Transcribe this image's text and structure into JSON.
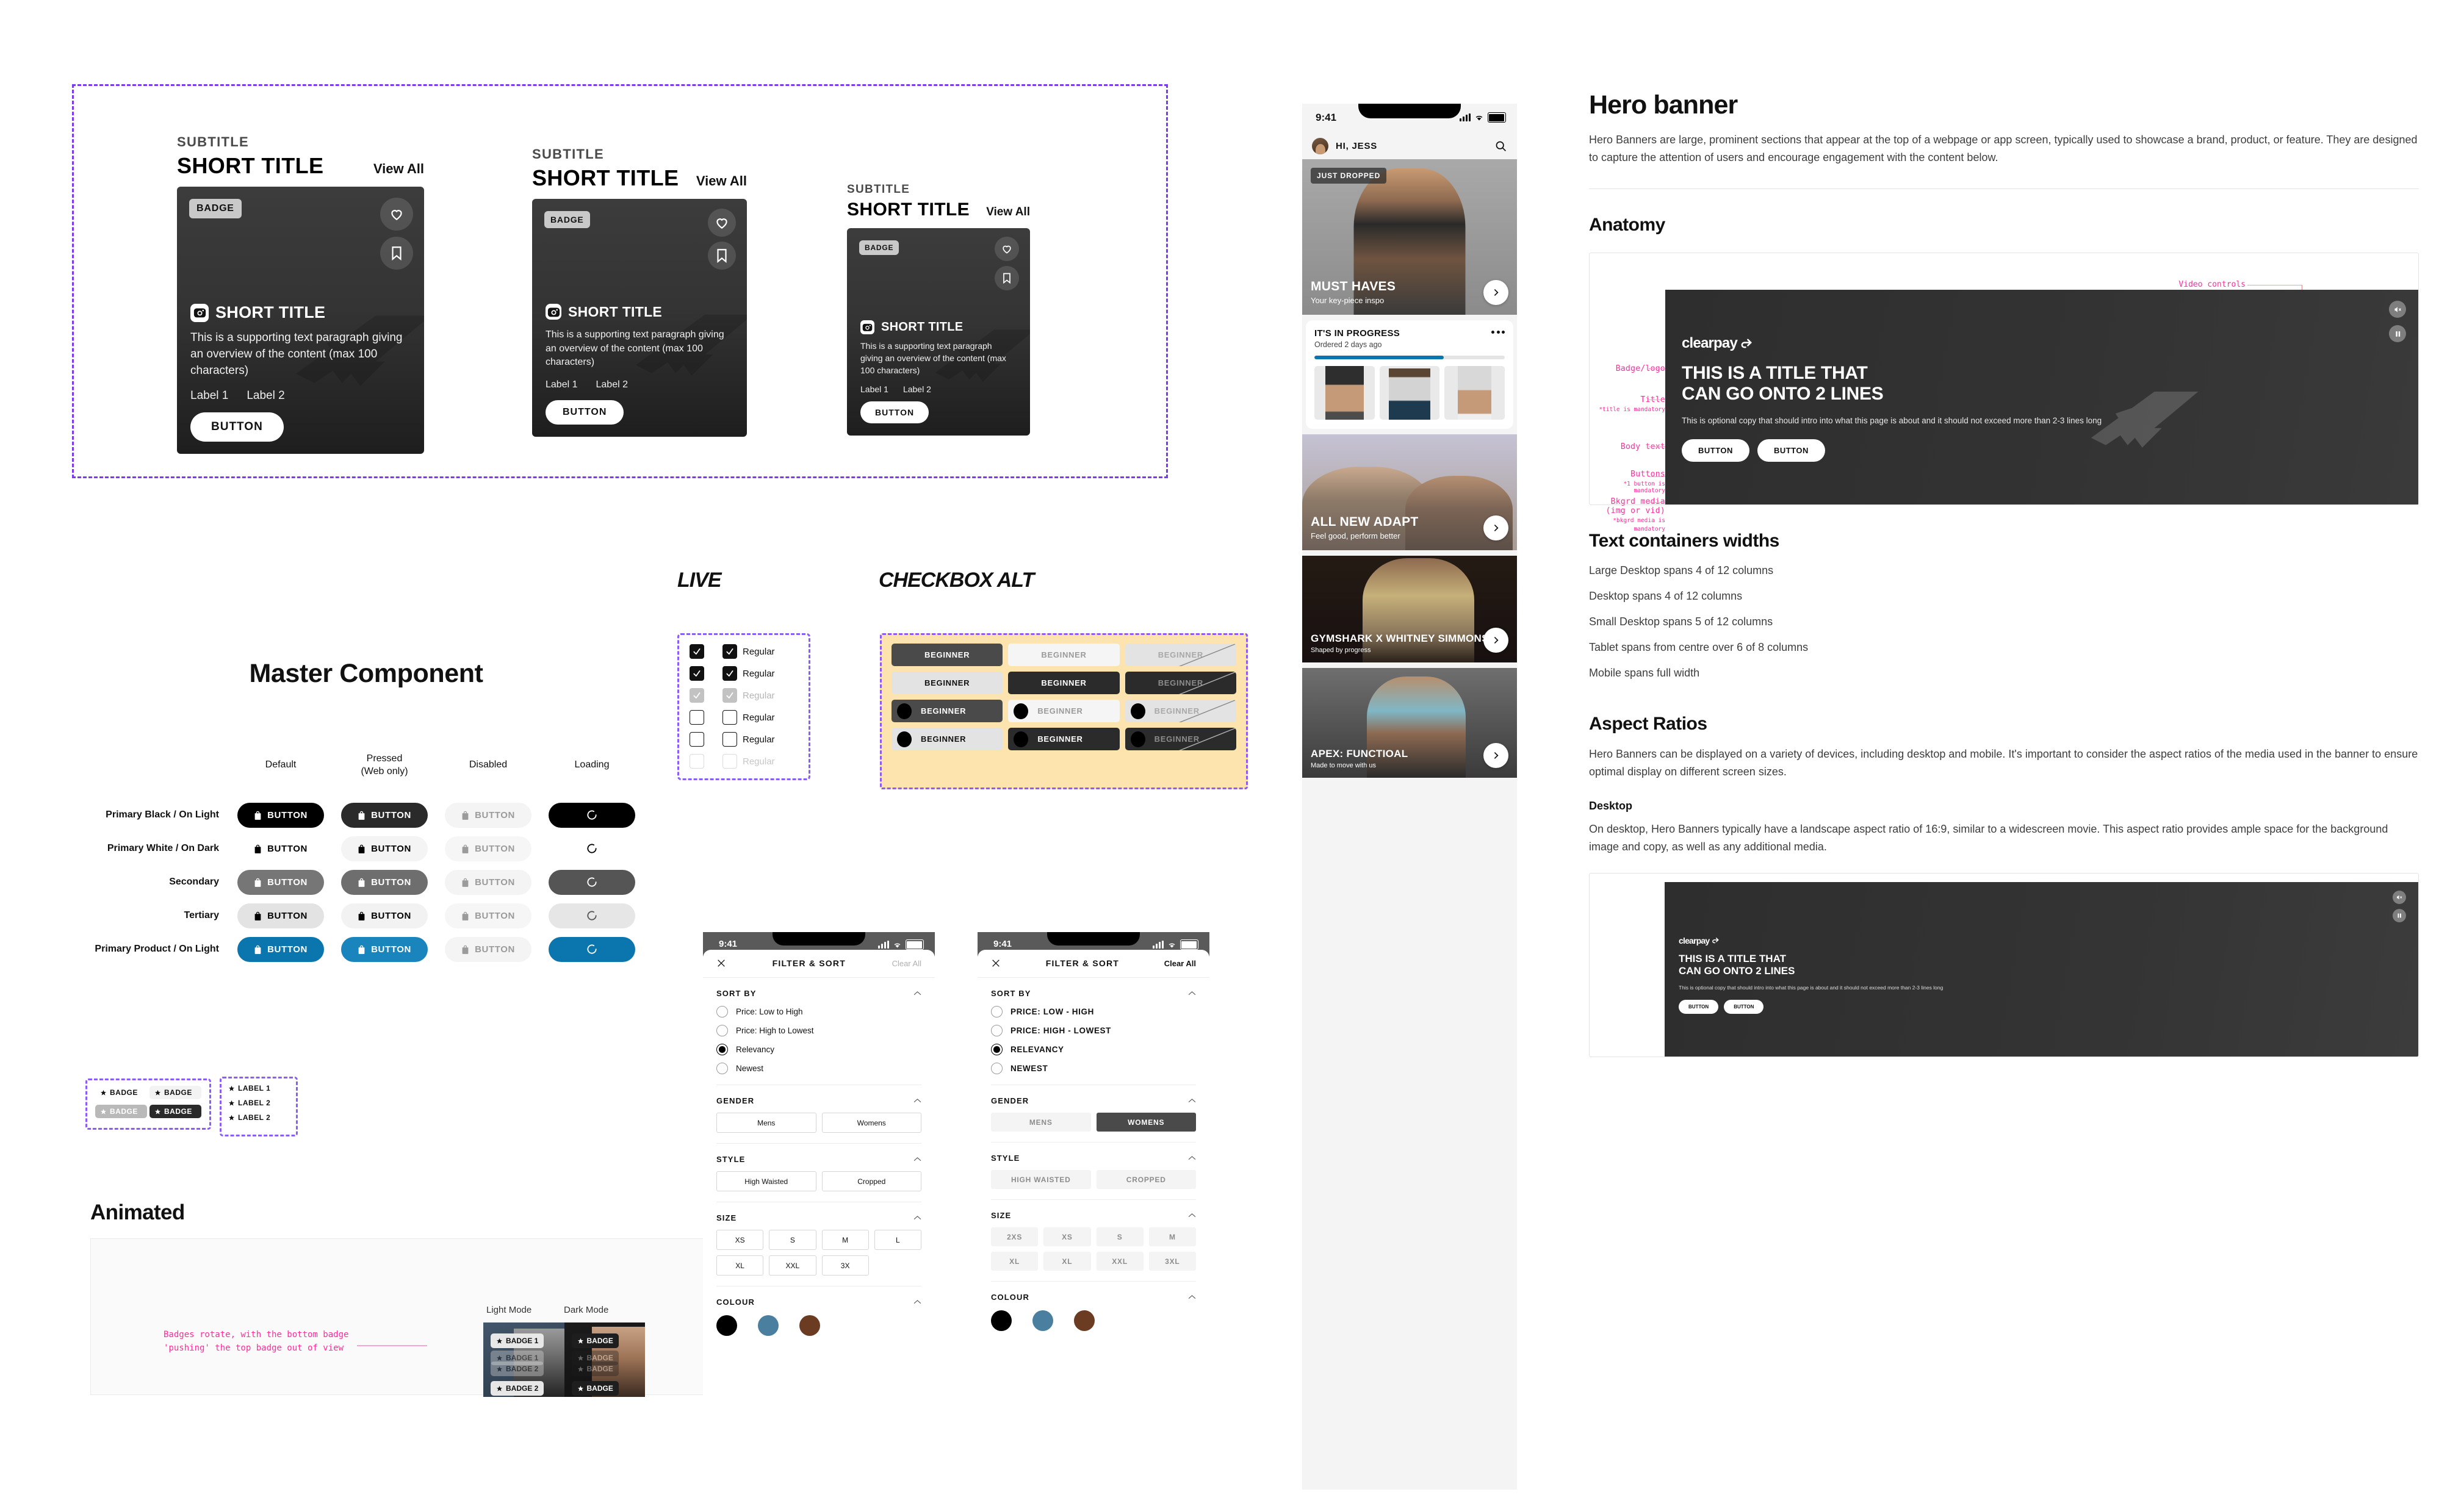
{
  "colors": {
    "product_blue": "#0b76ad",
    "annotation_pink": "#ff2d9b",
    "badge_grey": "#c9c9c9",
    "alt_panel_yellow": "#fde4ae",
    "dashed_purple": "#7c3aed"
  },
  "card_group": {
    "cards": [
      {
        "subtitle": "SUBTITLE",
        "title": "SHORT TITLE",
        "view_all": "View All",
        "badge": "BADGE",
        "card_title": "SHORT TITLE",
        "paragraph": "This is a supporting text paragraph giving an overview of the content (max 100 characters)",
        "label1": "Label 1",
        "label2": "Label 2",
        "button": "BUTTON"
      },
      {
        "subtitle": "SUBTITLE",
        "title": "SHORT TITLE",
        "view_all": "View All",
        "badge": "BADGE",
        "card_title": "SHORT TITLE",
        "paragraph": "This is a supporting text paragraph giving an overview of the content (max 100 characters)",
        "label1": "Label 1",
        "label2": "Label 2",
        "button": "BUTTON"
      },
      {
        "subtitle": "SUBTITLE",
        "title": "SHORT TITLE",
        "view_all": "View All",
        "badge": "BADGE",
        "card_title": "SHORT TITLE",
        "paragraph": "This is a supporting text paragraph giving an overview of the content (max 100 characters)",
        "label1": "Label 1",
        "label2": "Label 2",
        "button": "BUTTON"
      }
    ]
  },
  "master_component": {
    "title": "Master Component",
    "columns": [
      "Default",
      "Pressed\n(Web only)",
      "Disabled",
      "Loading"
    ],
    "columns_display": [
      {
        "line1": "Default",
        "line2": ""
      },
      {
        "line1": "Pressed",
        "line2": "(Web only)"
      },
      {
        "line1": "Disabled",
        "line2": ""
      },
      {
        "line1": "Loading",
        "line2": ""
      }
    ],
    "rows": [
      {
        "label": "Primary Black / On Light",
        "button_label": "BUTTON"
      },
      {
        "label": "Primary White / On Dark",
        "button_label": "BUTTON"
      },
      {
        "label": "Secondary",
        "button_label": "BUTTON"
      },
      {
        "label": "Tertiary",
        "button_label": "BUTTON"
      },
      {
        "label": "Primary Product / On Light",
        "button_label": "BUTTON"
      }
    ]
  },
  "live": {
    "title": "LIVE",
    "rows": [
      {
        "label": "Regular",
        "state": "checked"
      },
      {
        "label": "Regular",
        "state": "checked"
      },
      {
        "label": "Regular",
        "state": "checked-disabled"
      },
      {
        "label": "Regular",
        "state": "unchecked"
      },
      {
        "label": "Regular",
        "state": "unchecked"
      },
      {
        "label": "Regular",
        "state": "unchecked-disabled"
      }
    ]
  },
  "checkbox_alt": {
    "title": "CHECKBOX ALT",
    "chips": [
      {
        "label": "BEGINNER",
        "variant": "dark-selected"
      },
      {
        "label": "BEGINNER",
        "variant": "light"
      },
      {
        "label": "BEGINNER",
        "variant": "light-disabled"
      },
      {
        "label": "BEGINNER",
        "variant": "grey"
      },
      {
        "label": "BEGINNER",
        "variant": "black"
      },
      {
        "label": "BEGINNER",
        "variant": "black-disabled"
      },
      {
        "label": "BEGINNER",
        "variant": "dark-selected",
        "dot": true
      },
      {
        "label": "BEGINNER",
        "variant": "light",
        "dot": true
      },
      {
        "label": "BEGINNER",
        "variant": "light-disabled",
        "dot": true
      },
      {
        "label": "BEGINNER",
        "variant": "grey",
        "dot": true
      },
      {
        "label": "BEGINNER",
        "variant": "black",
        "dot": true
      },
      {
        "label": "BEGINNER",
        "variant": "black-disabled",
        "dot": true
      }
    ]
  },
  "badges": {
    "group_a": [
      {
        "label": "BADGE",
        "variant": "plain"
      },
      {
        "label": "BADGE",
        "variant": "light"
      },
      {
        "label": "BADGE",
        "variant": "grey"
      },
      {
        "label": "BADGE",
        "variant": "dark"
      }
    ],
    "group_b": [
      {
        "label": "LABEL 1"
      },
      {
        "label": "LABEL 2"
      },
      {
        "label": "LABEL 2"
      }
    ]
  },
  "animated": {
    "title": "Animated",
    "note": "Badges rotate, with the bottom badge 'pushing' the top badge out of view",
    "light_mode_label": "Light Mode",
    "dark_mode_label": "Dark Mode",
    "light_badges": [
      "BADGE 1",
      "BADGE 1",
      "BADGE 2",
      "BADGE 2"
    ],
    "dark_badges": [
      "BADGE",
      "BADGE",
      "BADGE",
      "BADGE"
    ]
  },
  "phone": {
    "status_time": "9:41",
    "greeting": "HI, JESS",
    "search_icon": "search-icon",
    "hero_cards": [
      {
        "badge": "JUST DROPPED",
        "title": "MUST HAVES",
        "subtitle": "Your key-piece inspo"
      },
      {
        "badge": "",
        "title": "ALL NEW ADAPT",
        "subtitle": "Feel good, perform better"
      },
      {
        "badge": "",
        "title": "GYMSHARK X WHITNEY SIMMONS",
        "subtitle": "Shaped by progress"
      },
      {
        "badge": "",
        "title": "APEX: FUNCTIOAL",
        "subtitle": "Made to move with us"
      }
    ],
    "progress_card": {
      "title": "IT'S IN PROGRESS",
      "subtitle": "Ordered 2 days ago",
      "progress_percent": 68,
      "menu_icon": "more-horizontal-icon"
    }
  },
  "filter_light": {
    "title": "FILTER & SORT",
    "clear_all": "Clear All",
    "status_time": "9:41",
    "sort_by": {
      "heading": "SORT BY",
      "options": [
        "Price: Low to High",
        "Price: High to Lowest",
        "Relevancy",
        "Newest"
      ],
      "selected": "Relevancy"
    },
    "gender": {
      "heading": "GENDER",
      "options": [
        "Mens",
        "Womens"
      ],
      "selected": ""
    },
    "style": {
      "heading": "STYLE",
      "options": [
        "High Waisted",
        "Cropped"
      ],
      "selected": ""
    },
    "size": {
      "heading": "SIZE",
      "options": [
        "XS",
        "S",
        "M",
        "L",
        "XL",
        "XXL",
        "3X"
      ],
      "selected": ""
    },
    "colour": {
      "heading": "COLOUR",
      "swatches": [
        "#000000",
        "#4a7fa0",
        "#6b3b22"
      ]
    }
  },
  "filter_dark": {
    "title": "FILTER & SORT",
    "clear_all": "Clear All",
    "status_time": "9:41",
    "sort_by": {
      "heading": "SORT BY",
      "options": [
        "PRICE: LOW - HIGH",
        "PRICE: HIGH - LOWEST",
        "RELEVANCY",
        "NEWEST"
      ],
      "selected": "RELEVANCY"
    },
    "gender": {
      "heading": "GENDER",
      "options": [
        "MENS",
        "WOMENS"
      ],
      "selected": "WOMENS"
    },
    "style": {
      "heading": "STYLE",
      "options": [
        "HIGH WAISTED",
        "CROPPED"
      ],
      "selected": ""
    },
    "size": {
      "heading": "SIZE",
      "options": [
        "2XS",
        "XS",
        "S",
        "M",
        "XL",
        "XL",
        "XXL",
        "3XL"
      ],
      "selected": ""
    },
    "colour": {
      "heading": "COLOUR",
      "swatches": [
        "#000000",
        "#4a7fa0",
        "#6b3b22"
      ]
    }
  },
  "doc": {
    "h1": "Hero banner",
    "intro": "Hero Banners are large, prominent sections that appear at the top of a webpage or app screen, typically used to showcase a brand, product, or feature. They are designed to capture the attention of users and encourage engagement with the content below.",
    "anatomy_heading": "Anatomy",
    "annotations": {
      "video_controls": "Video controls",
      "badge_logo": "Badge/logo",
      "title": "Title",
      "title_note": "*title is mandatory",
      "body_text": "Body text",
      "buttons": "Buttons",
      "buttons_note": "*1 button is mandatory",
      "bkgrd_media": "Bkgrd media\n(img or vid)",
      "bkgrd_media_l1": "Bkgrd media",
      "bkgrd_media_l2": "(img or vid)",
      "bkgrd_media_note_l1": "*bkgrd media is",
      "bkgrd_media_note_l2": "mandatory"
    },
    "banner": {
      "logo": "clearpay",
      "title_l1": "THIS IS A TITLE THAT",
      "title_l2": "CAN GO ONTO 2 LINES",
      "body": "This is optional copy that should intro into what this page is about and it should not exceed more than 2-3 lines long",
      "button1": "BUTTON",
      "button2": "BUTTON",
      "mute_icon": "mute-icon",
      "pause_icon": "pause-icon"
    },
    "text_widths_heading": "Text containers widths",
    "text_widths": [
      "Large Desktop spans 4 of 12 columns",
      "Desktop spans 4 of 12 columns",
      "Small Desktop spans 5 of 12 columns",
      "Tablet spans from centre over 6 of 8 columns",
      "Mobile spans full width"
    ],
    "aspect_heading": "Aspect Ratios",
    "aspect_p": "Hero Banners can be displayed on a variety of devices, including desktop and mobile. It's important to consider the aspect ratios of the media used in the banner to ensure optimal display on different screen sizes.",
    "desktop_heading": "Desktop",
    "desktop_p": "On desktop, Hero Banners typically have a landscape aspect ratio of 16:9, similar to a widescreen movie. This aspect ratio provides ample space for the background image and copy, as well as any additional media."
  }
}
